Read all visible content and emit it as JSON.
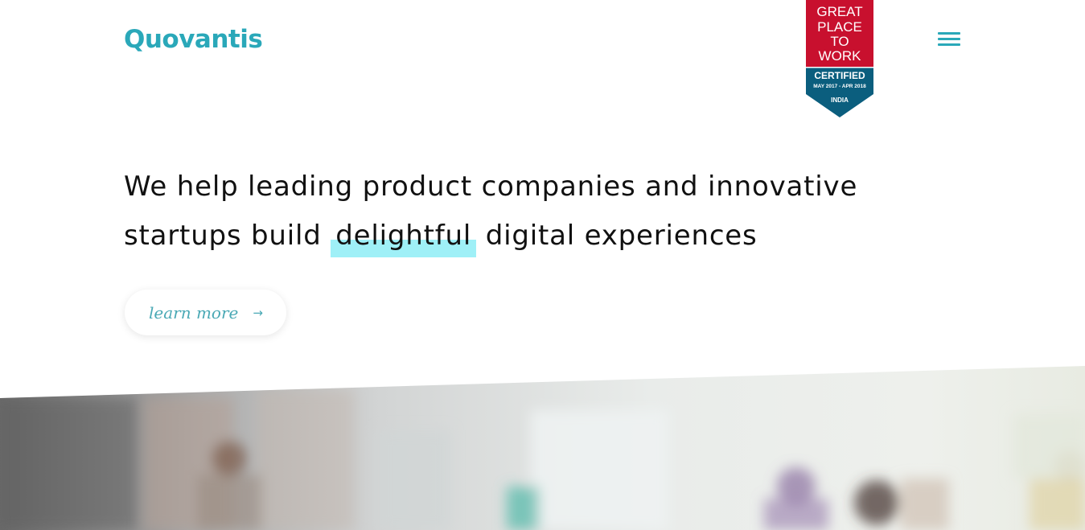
{
  "header": {
    "logo_text": "Quovantis",
    "menu_icon": "hamburger-menu-icon"
  },
  "badge": {
    "line1": "GREAT",
    "line2": "PLACE",
    "line3": "TO",
    "line4": "WORK",
    "certified": "CERTIFIED",
    "dates": "MAY 2017 - APR 2018",
    "country": "INDIA"
  },
  "hero": {
    "headline_part1": "We help leading product companies and innovative startups build",
    "headline_highlight": "delightful",
    "headline_part2": "digital experiences",
    "cta_label": "learn more",
    "cta_arrow": "→"
  },
  "colors": {
    "brand": "#2aa8b9",
    "highlight": "#9ff0f7",
    "badge_red": "#c8102e",
    "badge_blue": "#0b5e7e"
  }
}
